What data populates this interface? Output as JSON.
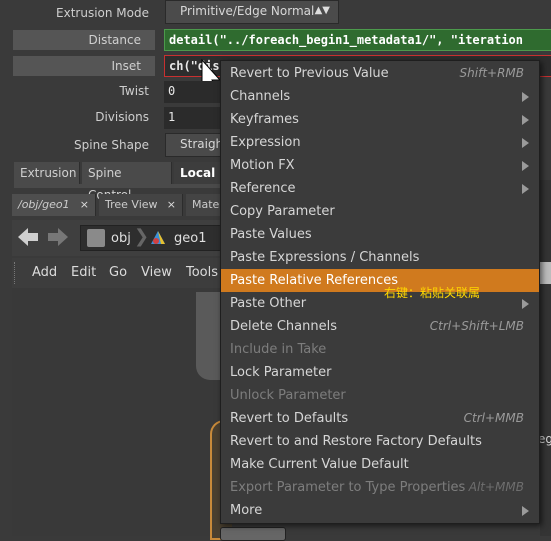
{
  "params": {
    "extrusion_mode": {
      "label": "Extrusion Mode",
      "value": "Primitive/Edge Normal"
    },
    "distance": {
      "label": "Distance",
      "expr": "detail(\"../foreach_begin1_metadata1/\", \"iteration"
    },
    "inset": {
      "label": "Inset",
      "expr": "ch(\"dis"
    },
    "twist": {
      "label": "Twist",
      "value": "0"
    },
    "divisions": {
      "label": "Divisions",
      "value": "1"
    },
    "spine_shape": {
      "label": "Spine Shape",
      "value": "Straigh"
    }
  },
  "param_tabs": [
    "Extrusion",
    "Spine Control",
    "Local C"
  ],
  "pane_tabs": [
    {
      "label": "/obj/geo1",
      "close": "×"
    },
    {
      "label": "Tree View",
      "close": "×"
    },
    {
      "label": "Mater"
    }
  ],
  "path": {
    "obj": "obj",
    "geo": "geo1"
  },
  "menubar": [
    "Add",
    "Edit",
    "Go",
    "View",
    "Tools"
  ],
  "right_edge_text": "egi",
  "context_menu": {
    "items": [
      {
        "label": "Revert to Previous Value",
        "shortcut": "Shift+RMB"
      },
      {
        "label": "Channels",
        "submenu": true
      },
      {
        "label": "Keyframes",
        "submenu": true
      },
      {
        "label": "Expression",
        "submenu": true
      },
      {
        "label": "Motion FX",
        "submenu": true
      },
      {
        "label": "Reference",
        "submenu": true
      },
      {
        "label": "Copy Parameter"
      },
      {
        "label": "Paste Values"
      },
      {
        "label": "Paste Expressions / Channels"
      },
      {
        "label": "Paste Relative References",
        "highlighted": true
      },
      {
        "label": "Paste Other",
        "submenu": true
      },
      {
        "label": "Delete Channels",
        "shortcut": "Ctrl+Shift+LMB"
      },
      {
        "label": "Include in Take",
        "disabled": true
      },
      {
        "label": "Lock Parameter"
      },
      {
        "label": "Unlock Parameter",
        "disabled": true
      },
      {
        "label": "Revert to Defaults",
        "shortcut": "Ctrl+MMB"
      },
      {
        "label": "Revert to and Restore Factory Defaults"
      },
      {
        "label": "Make Current Value Default"
      },
      {
        "label": "Export Parameter to Type Properties",
        "shortcut": "Alt+MMB",
        "disabled": true
      },
      {
        "label": "More",
        "submenu": true
      }
    ]
  },
  "annotation": {
    "text": "右键：粘贴关联属",
    "color": "#ffd700"
  },
  "colors": {
    "highlight": "#d07a1e",
    "expr_green": "#2f6b2f",
    "inset_border": "#c83030"
  }
}
